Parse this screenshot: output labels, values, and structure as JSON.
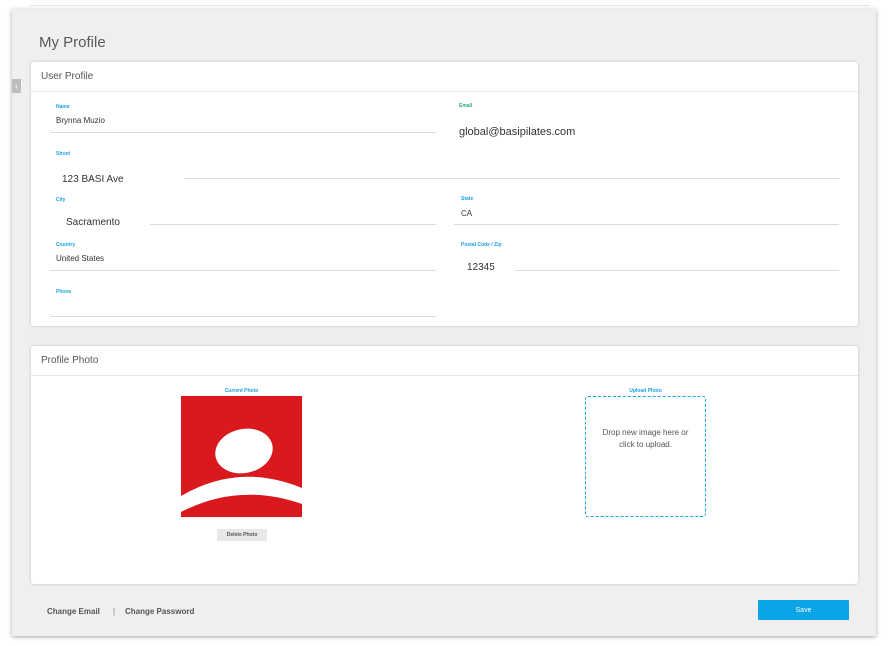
{
  "page": {
    "title": "My Profile"
  },
  "user_profile": {
    "header": "User Profile",
    "fields": {
      "name": {
        "label": "Name",
        "value": "Brynna Muzio"
      },
      "email": {
        "label": "Email",
        "value": "global@basipilates.com"
      },
      "street": {
        "label": "Street",
        "value": "123 BASI Ave"
      },
      "city": {
        "label": "City",
        "value": "Sacramento"
      },
      "state": {
        "label": "State",
        "value": "CA"
      },
      "country": {
        "label": "Country",
        "value": "United States"
      },
      "postal": {
        "label": "Postal Code / Zip",
        "value": "12345"
      },
      "phone": {
        "label": "Phone",
        "value": ""
      }
    }
  },
  "profile_photo": {
    "header": "Profile Photo",
    "current_label": "Current Photo",
    "delete_label": "Delete Photo",
    "upload_label": "Upload Photo",
    "drop_text": "Drop new image here or click to upload.",
    "logo_color": "#d9191d"
  },
  "footer": {
    "change_email": "Change Email",
    "separator": "|",
    "change_password": "Change Password",
    "save": "Save"
  },
  "colors": {
    "accent": "#0ba4e6",
    "label_blue": "#1aa1e1",
    "label_green": "#26b06a"
  },
  "icons": {
    "collapse": "chevron-left-icon"
  }
}
